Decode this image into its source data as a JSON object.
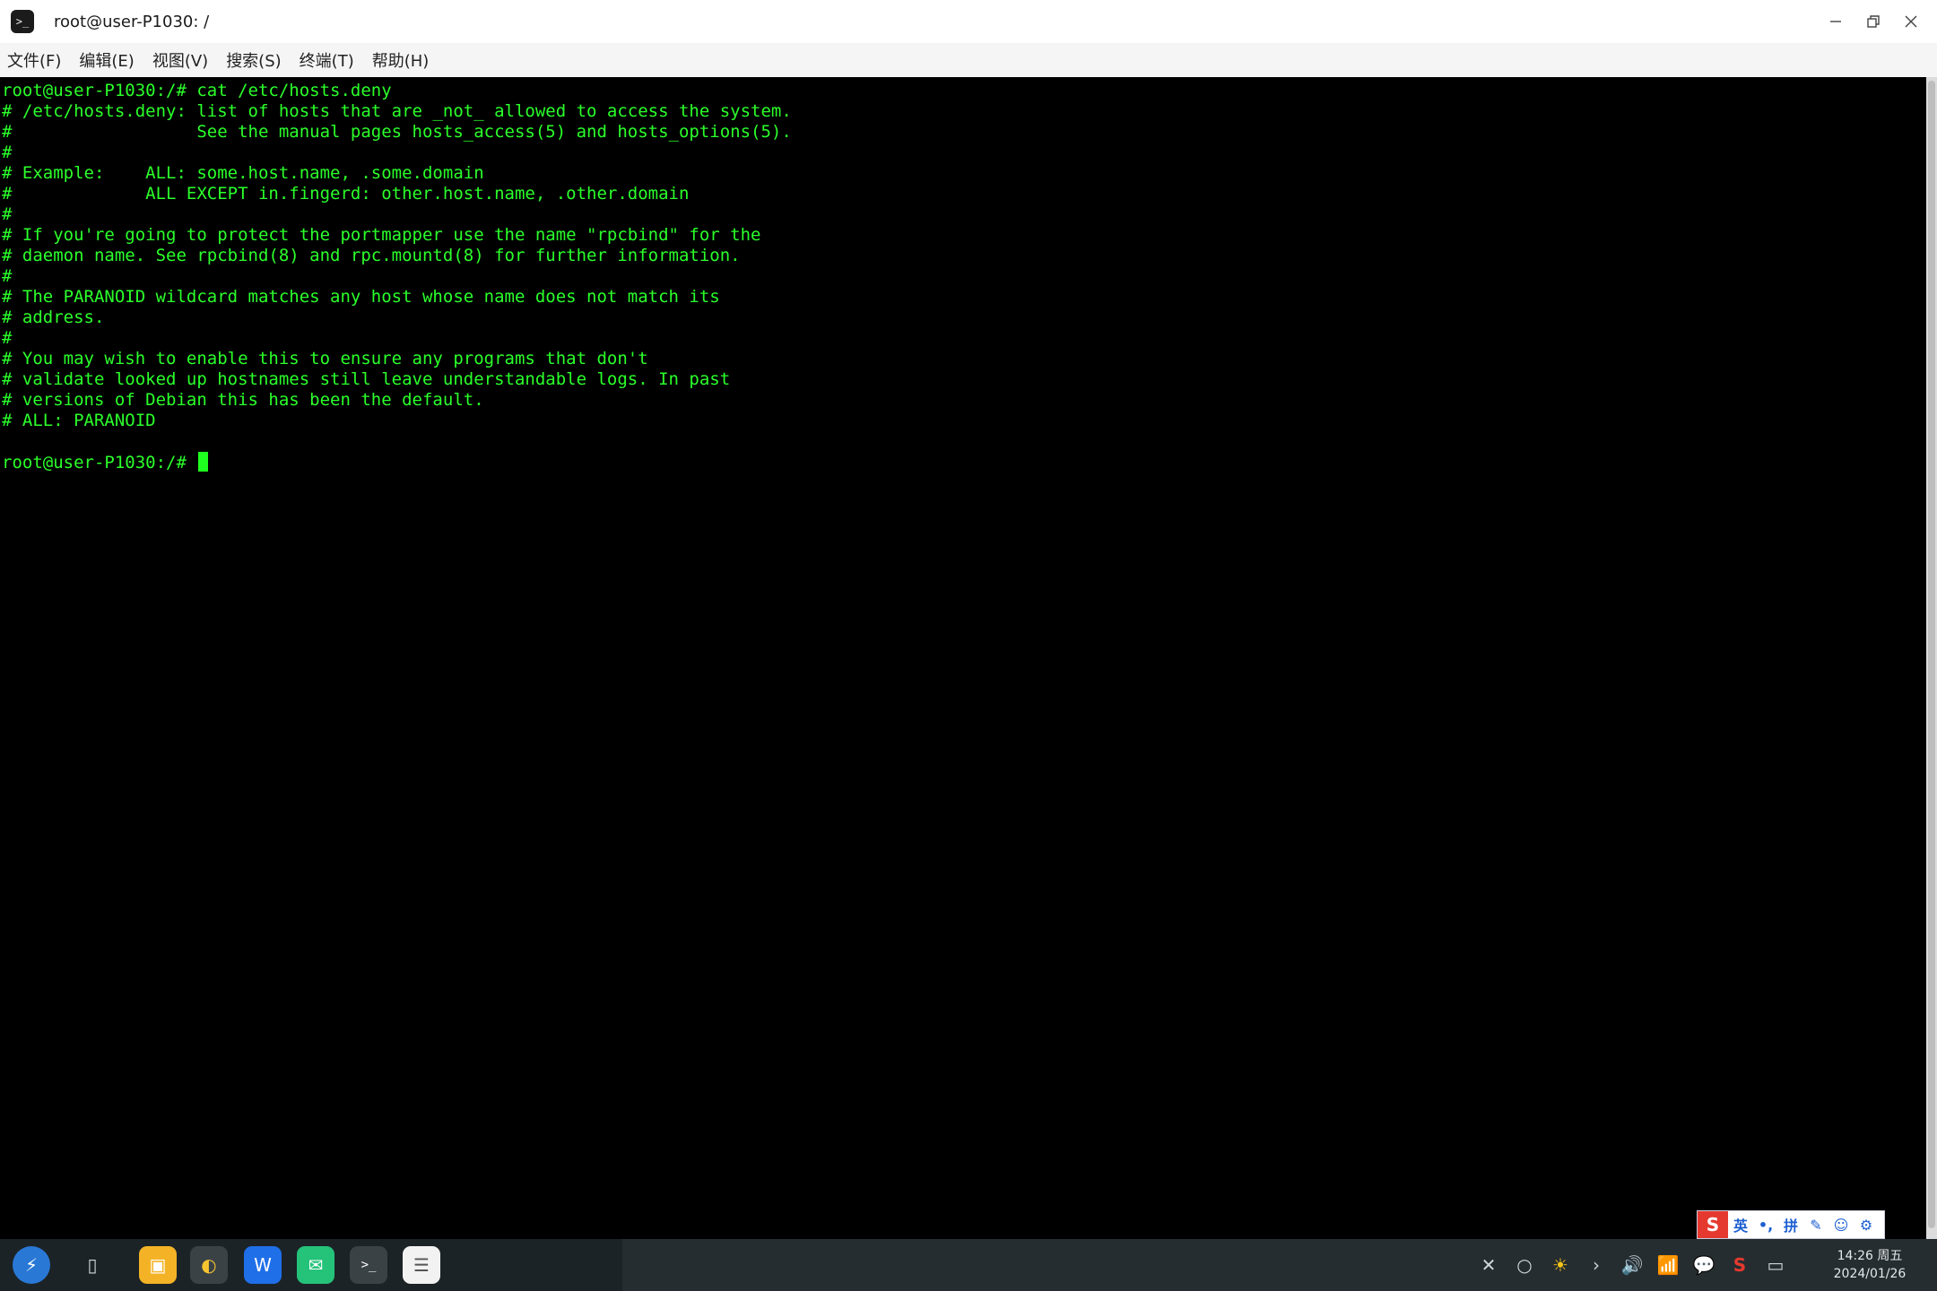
{
  "window": {
    "title": "root@user-P1030: /",
    "app_icon_glyph": ">_"
  },
  "menu": [
    "文件(F)",
    "编辑(E)",
    "视图(V)",
    "搜索(S)",
    "终端(T)",
    "帮助(H)"
  ],
  "terminal": {
    "lines": [
      "root@user-P1030:/# cat /etc/hosts.deny",
      "# /etc/hosts.deny: list of hosts that are _not_ allowed to access the system.",
      "#                  See the manual pages hosts_access(5) and hosts_options(5).",
      "#",
      "# Example:    ALL: some.host.name, .some.domain",
      "#             ALL EXCEPT in.fingerd: other.host.name, .other.domain",
      "#",
      "# If you're going to protect the portmapper use the name \"rpcbind\" for the",
      "# daemon name. See rpcbind(8) and rpc.mountd(8) for further information.",
      "#",
      "# The PARANOID wildcard matches any host whose name does not match its",
      "# address.",
      "#",
      "# You may wish to enable this to ensure any programs that don't",
      "# validate looked up hostnames still leave understandable logs. In past",
      "# versions of Debian this has been the default.",
      "# ALL: PARANOID",
      ""
    ],
    "prompt": "root@user-P1030:/# ",
    "text_color": "#2bff2b",
    "background": "#000000"
  },
  "ime": {
    "logo": "S",
    "items": [
      "英",
      "•,",
      "拼",
      "✎",
      "☺",
      "⚙"
    ]
  },
  "taskbar": {
    "apps": [
      {
        "name": "launcher-icon",
        "glyph": "⚡"
      },
      {
        "name": "multitask-view-icon",
        "glyph": "▯"
      },
      {
        "name": "file-manager-icon",
        "glyph": "▣"
      },
      {
        "name": "browser-icon",
        "glyph": "◐"
      },
      {
        "name": "wps-writer-icon",
        "glyph": "W"
      },
      {
        "name": "messenger-icon",
        "glyph": "✉"
      },
      {
        "name": "terminal-icon",
        "glyph": ">_"
      },
      {
        "name": "text-editor-icon",
        "glyph": "☰"
      }
    ],
    "tray": [
      "✕",
      "○",
      "☀",
      "›",
      "🔊",
      "📶",
      "💬",
      "S",
      "▭"
    ],
    "clock_time": "14:26 周五",
    "clock_date": "2024/01/26"
  }
}
